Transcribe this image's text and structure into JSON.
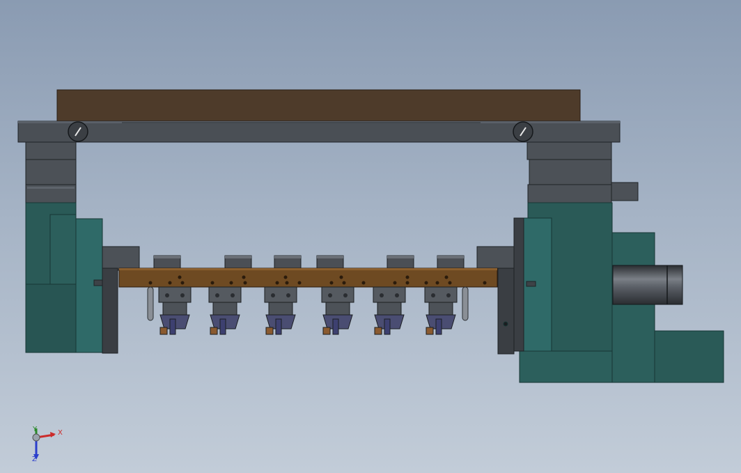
{
  "viewport": {
    "background_top": "#8a9bb2",
    "background_bottom": "#c2ccd8"
  },
  "model": {
    "colors": {
      "top_plate": "#4e3b2a",
      "beam": "#4a4f55",
      "column": "#4c5157",
      "base_teal": "#2a5a57",
      "disc_teal": "#2f6a68",
      "wood_bar": "#6e4a22",
      "cylinder": "#4b4f55",
      "clamp": "#555a60",
      "clamp_purple": "#4a4d72"
    },
    "clamp_unit_count": 6
  },
  "triad": {
    "x_label": "X",
    "y_label": "Y",
    "z_label": "Z",
    "x_color": "#cc2b2b",
    "y_color": "#2b8a2b",
    "z_color": "#2b3fcc"
  }
}
